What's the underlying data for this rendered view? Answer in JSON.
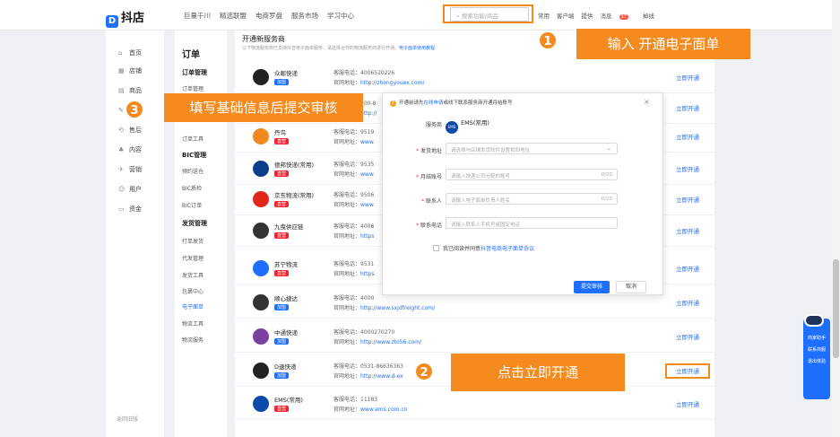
{
  "topbar": {
    "logo": "抖店",
    "logo_mark": "D",
    "nav": [
      "巨量千川",
      "精选联盟",
      "电商罗盘",
      "服务市场",
      "学习中心"
    ],
    "search_placeholder": "搜索功能/商品",
    "links": [
      "常用",
      "客户端",
      "提供",
      "消息",
      "掉线"
    ],
    "badge": "37"
  },
  "sidebar": {
    "items": [
      {
        "icon": "⌂",
        "label": "首页"
      },
      {
        "icon": "▦",
        "label": "店铺"
      },
      {
        "icon": "▤",
        "label": "商品"
      },
      {
        "icon": "✎",
        "label": "订单"
      },
      {
        "icon": "⟲",
        "label": "售后"
      },
      {
        "icon": "♣",
        "label": "内容"
      },
      {
        "icon": "✈",
        "label": "营销"
      },
      {
        "icon": "☺",
        "label": "用户"
      },
      {
        "icon": "▭",
        "label": "资金"
      }
    ],
    "bottom": "返回旧版"
  },
  "subnav": {
    "title": "订单",
    "group1": "订单管理",
    "g1_items": [
      "订单管理",
      "订单工具"
    ],
    "group2": "BIC管理",
    "g2_items": [
      "预约送仓",
      "BIC质检",
      "BIC订单"
    ],
    "group3": "发货管理",
    "g3_items": [
      "打单发货",
      "代发管理",
      "发货工具",
      "包裹中心",
      "电子面单",
      "物流工具",
      "物流服务"
    ]
  },
  "main": {
    "title": "开通新服务商",
    "desc": "以下物流服务商已支持抖音电子面单服务，请选择合作的物流服务商进行开通。",
    "desc_link": "电子面单使用教程",
    "open_label": "立即开通",
    "tel_prefix": "客服电话：",
    "web_prefix": "官网地址：",
    "rows": [
      {
        "name": "众邮快递",
        "tag": "加盟",
        "tel": "4006520226",
        "web": "http://zhongyouex.com/",
        "color": "#222"
      },
      {
        "name": "",
        "tag": "",
        "tel": "400-8",
        "web": "http://",
        "color": "#fff"
      },
      {
        "name": "丹鸟",
        "tag": "直营",
        "tel": "9519",
        "web": "www.",
        "color": "#f08a1e"
      },
      {
        "name": "德邦快递(常用)",
        "tag": "直营",
        "tel": "9535",
        "web": "www.",
        "color": "#0d3f8a"
      },
      {
        "name": "京东物流(常用)",
        "tag": "直营",
        "tel": "9506",
        "web": "www.",
        "color": "#e1251b"
      },
      {
        "name": "九曳供应链",
        "tag": "直营",
        "tel": "4006",
        "web": "https",
        "color": "#333"
      },
      {
        "name": "苏宁物流",
        "tag": "直营",
        "tel": "9531",
        "web": "https",
        "color": "#1f6fff"
      },
      {
        "name": "顺心捷达",
        "tag": "加盟",
        "tel": "4000",
        "web": "http://www.sxjdfreight.com/",
        "color": "#333"
      },
      {
        "name": "中通快递",
        "tag": "加盟",
        "tel": "4000270270",
        "web": "http://www.zto56.com/",
        "color": "#7b3fa0"
      },
      {
        "name": "D速快递",
        "tag": "加盟",
        "tel": "0531-86636363",
        "web": "http://www.d-ex",
        "color": "#222"
      },
      {
        "name": "EMS(常用)",
        "tag": "直营",
        "tel": "11183",
        "web": "www.ems.com.cn",
        "color": "#0b4aa8"
      }
    ]
  },
  "modal": {
    "header_pre": "开通前请先",
    "header_link": "在线申请",
    "header_post": "或线下联系服务商开通月结账号",
    "close": "×",
    "service_label": "服务商",
    "service_value": "EMS(常用)",
    "ems_text": "EMS",
    "fields": [
      {
        "label": "发货地址",
        "placeholder": "请选择与店铺发货软件设置相同地址",
        "count": ""
      },
      {
        "label": "月结账号",
        "placeholder": "请输入快递公司分配的账号",
        "count": "0/20"
      },
      {
        "label": "联系人",
        "placeholder": "请输入电子面单负责人姓名",
        "count": "0/20"
      },
      {
        "label": "联系电话",
        "placeholder": "请输入联系人手机号或固定电话",
        "count": ""
      }
    ],
    "agree_pre": "我已阅读并同意",
    "agree_link": "抖音电商电子面单协议",
    "submit": "提交审核",
    "cancel": "取消"
  },
  "callouts": {
    "c1_num": "1",
    "c1_text": "输入 开通电子面单",
    "c2_num": "2",
    "c2_text": "点击立即开通",
    "c3_num": "3",
    "c3_text": "填写基础信息后提交审核"
  },
  "helper": {
    "items": [
      "商家助手",
      "联系商服",
      "退出体验"
    ]
  },
  "colors": {
    "accent": "#1f6fff",
    "callout": "#f58a1f"
  }
}
